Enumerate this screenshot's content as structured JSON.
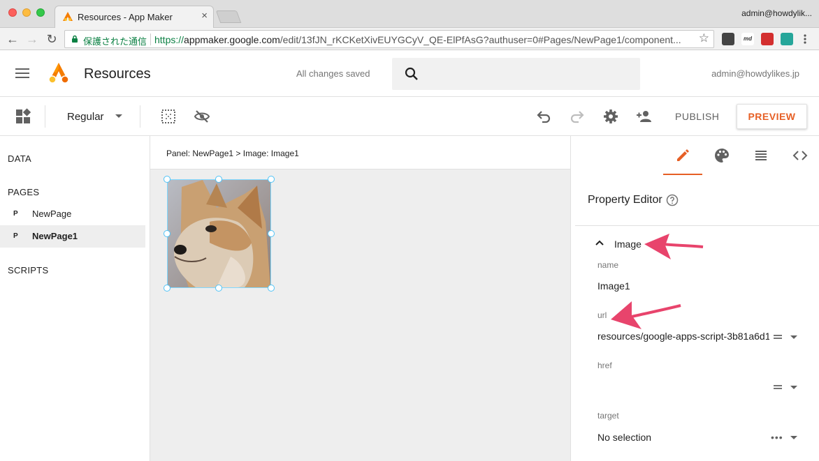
{
  "browser": {
    "tab_title": "Resources - App Maker",
    "tab_close": "×",
    "profile": "admin@howdylik...",
    "secure_label": "保護された通信",
    "url_scheme": "https://",
    "url_host": "appmaker.google.com",
    "url_path": "/edit/13fJN_rKCKetXivEUYGCyV_QE-ElPfAsG?authuser=0#Pages/NewPage1/component...",
    "bookmark_star": "☆",
    "back": "←",
    "forward": "→",
    "reload": "↻",
    "extensions": [
      "md"
    ]
  },
  "header": {
    "title": "Resources",
    "save_status": "All changes saved",
    "user_email": "admin@howdylikes.jp"
  },
  "toolbar": {
    "device_select": "Regular",
    "publish_label": "PUBLISH",
    "preview_label": "PREVIEW"
  },
  "sidebar": {
    "data_label": "DATA",
    "pages_label": "PAGES",
    "scripts_label": "SCRIPTS",
    "pages": [
      {
        "badge": "P",
        "label": "NewPage"
      },
      {
        "badge": "P",
        "label": "NewPage1"
      }
    ]
  },
  "canvas": {
    "breadcrumb": "Panel: NewPage1 > Image: Image1"
  },
  "property_editor": {
    "title": "Property Editor",
    "section": "Image",
    "fields": {
      "name_label": "name",
      "name_value": "Image1",
      "url_label": "url",
      "url_value": "resources/google-apps-script-3b81a6d1",
      "href_label": "href",
      "href_value": "",
      "target_label": "target",
      "target_value": "No selection",
      "dots": "•••"
    }
  },
  "colors": {
    "accent": "#e65f25",
    "annotation": "#e8446c",
    "selection": "#4fc3f7"
  }
}
